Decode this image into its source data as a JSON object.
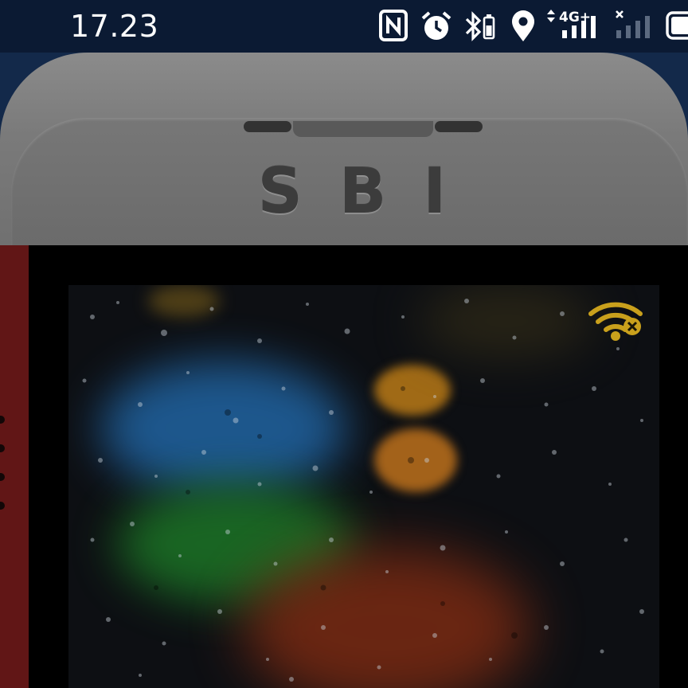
{
  "status_bar": {
    "time": "17.23",
    "network_label": "4G+"
  },
  "device": {
    "brand": "SBI"
  },
  "colors": {
    "status_bar_bg": "#0b1a33",
    "device_body": "#7a7a7a",
    "side_strip": "#611616",
    "wifi_icon": "#c9a01c"
  },
  "icons": [
    "nfc-icon",
    "alarm-icon",
    "bluetooth-battery-icon",
    "location-icon",
    "signal-4g-icon",
    "signal-no-sim-icon",
    "battery-icon",
    "wifi-off-icon"
  ]
}
